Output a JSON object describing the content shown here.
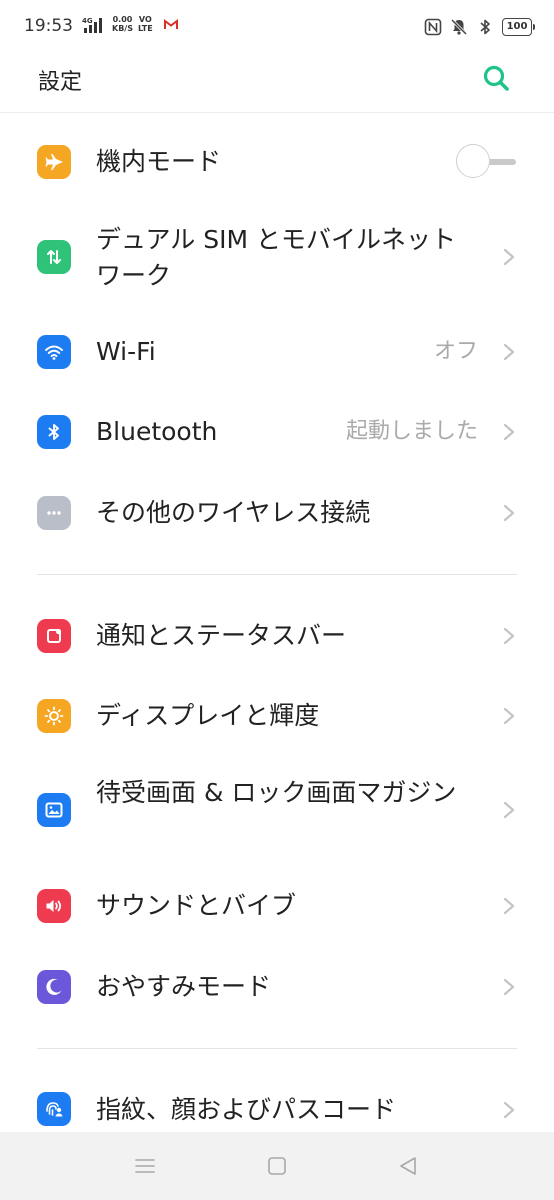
{
  "status_bar": {
    "time": "19:53",
    "network_label": "4G",
    "speed_value": "0.00",
    "speed_unit": "KB/S",
    "volte_top": "VO",
    "volte_bottom": "LTE",
    "battery": "100",
    "icons": [
      "signal-icon",
      "gmail-icon",
      "nfc-icon",
      "mute-icon",
      "bluetooth-icon",
      "battery-icon"
    ]
  },
  "header": {
    "title": "設定",
    "search_icon": "search-icon",
    "accent_color": "#1ec487"
  },
  "sections": [
    {
      "items": [
        {
          "label": "機内モード",
          "icon": "airplane-icon",
          "icon_color": "#f5a623",
          "control": "toggle",
          "toggle_on": false
        },
        {
          "label": "デュアル SIM とモバイルネットワーク",
          "icon": "mobile-data-icon",
          "icon_color": "#2fc37a",
          "control": "chevron"
        },
        {
          "label": "Wi-Fi",
          "icon": "wifi-icon",
          "icon_color": "#1e7cf2",
          "value": "オフ",
          "control": "chevron"
        },
        {
          "label": "Bluetooth",
          "icon": "bluetooth-icon",
          "icon_color": "#1e7cf2",
          "value": "起動しました",
          "control": "chevron"
        },
        {
          "label": "その他のワイヤレス接続",
          "icon": "more-icon",
          "icon_color": "#b9bec8",
          "control": "chevron"
        }
      ]
    },
    {
      "items": [
        {
          "label": "通知とステータスバー",
          "icon": "notification-icon",
          "icon_color": "#ee3b50",
          "control": "chevron"
        },
        {
          "label": "ディスプレイと輝度",
          "icon": "brightness-icon",
          "icon_color": "#f5a623",
          "control": "chevron"
        },
        {
          "label": "待受画面 & ロック画面マガジン",
          "icon": "wallpaper-icon",
          "icon_color": "#1e7cf2",
          "control": "chevron"
        },
        {
          "label": "サウンドとバイブ",
          "icon": "sound-icon",
          "icon_color": "#ee3b50",
          "control": "chevron"
        },
        {
          "label": "おやすみモード",
          "icon": "moon-icon",
          "icon_color": "#6a57d9",
          "control": "chevron"
        }
      ]
    },
    {
      "items": [
        {
          "label": "指紋、顔およびパスコード",
          "icon": "fingerprint-face-icon",
          "icon_color": "#1e7cf2",
          "control": "chevron"
        }
      ]
    }
  ],
  "nav_bar": {
    "buttons": [
      "menu-icon",
      "home-icon",
      "back-icon"
    ]
  }
}
